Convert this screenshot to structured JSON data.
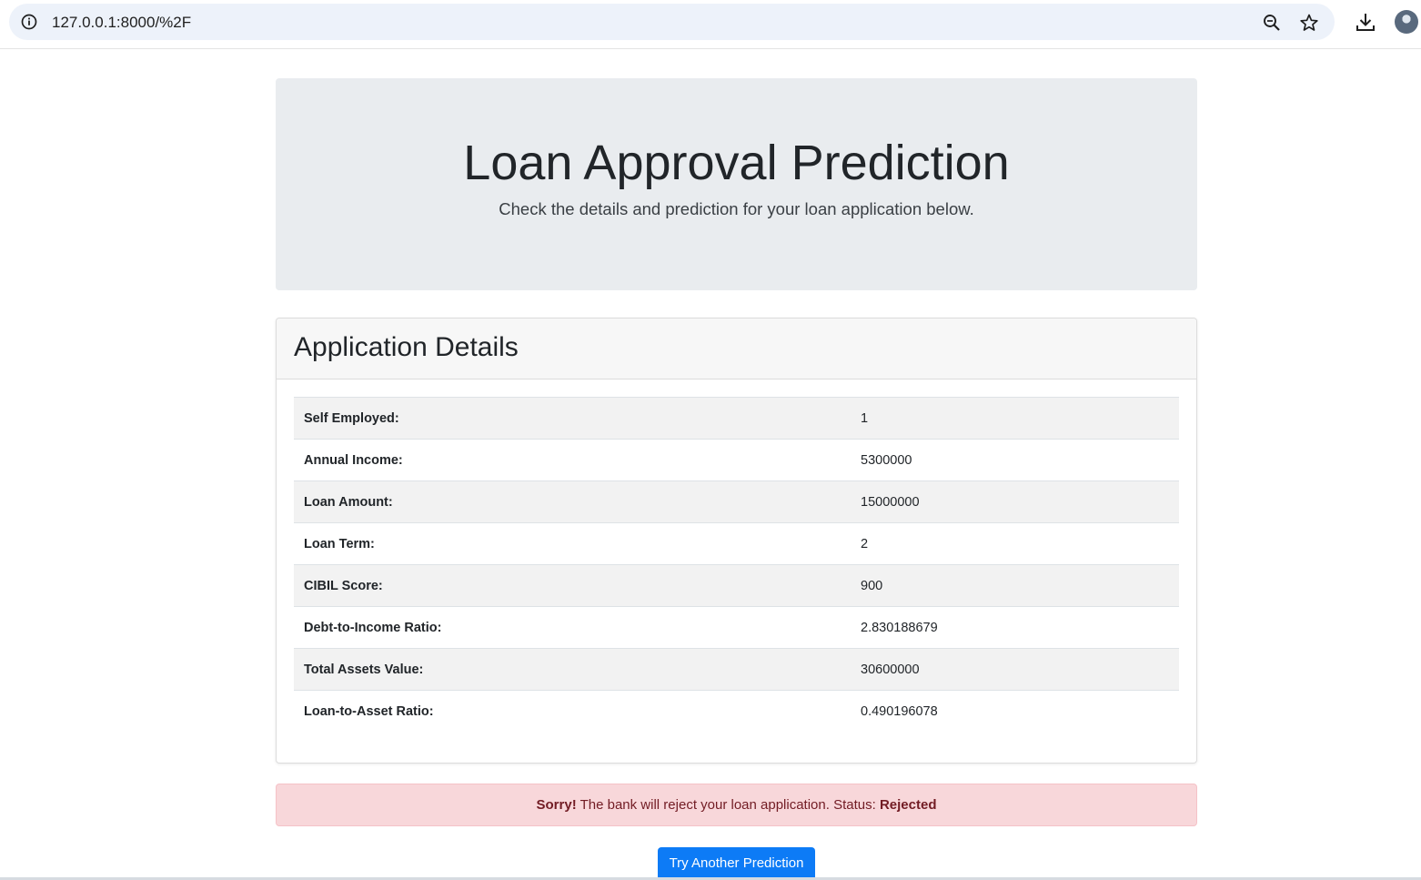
{
  "browser": {
    "url": "127.0.0.1:8000/%2F",
    "icons": [
      "info-icon",
      "zoom-icon",
      "bookmark-star-icon",
      "download-icon",
      "profile-avatar"
    ]
  },
  "hero": {
    "title": "Loan Approval Prediction",
    "lead": "Check the details and prediction for your loan application below."
  },
  "details": {
    "heading": "Application Details",
    "rows": [
      {
        "label": "Self Employed:",
        "value": "1"
      },
      {
        "label": "Annual Income:",
        "value": "5300000"
      },
      {
        "label": "Loan Amount:",
        "value": "15000000"
      },
      {
        "label": "Loan Term:",
        "value": "2"
      },
      {
        "label": "CIBIL Score:",
        "value": "900"
      },
      {
        "label": "Debt-to-Income Ratio:",
        "value": "2.830188679"
      },
      {
        "label": "Total Assets Value:",
        "value": "30600000"
      },
      {
        "label": "Loan-to-Asset Ratio:",
        "value": "0.490196078"
      }
    ]
  },
  "result": {
    "prefix": "Sorry!",
    "message": " The bank will reject your loan application. Status: ",
    "status": "Rejected"
  },
  "actions": {
    "retry_label": "Try Another Prediction"
  },
  "colors": {
    "primary": "#0d7bf6",
    "danger_bg": "#f8d7da",
    "danger_text": "#721c24",
    "jumbotron_bg": "#e9ecef"
  }
}
